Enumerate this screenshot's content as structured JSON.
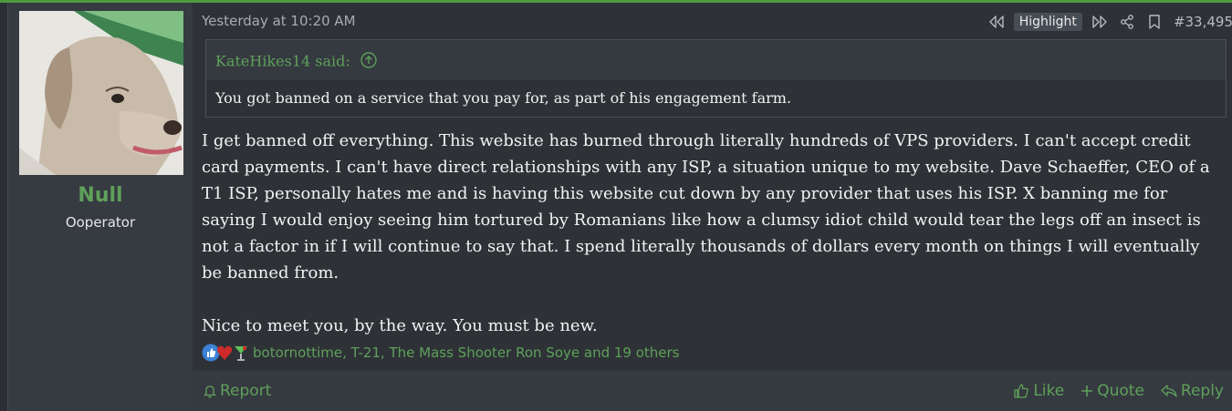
{
  "post": {
    "author": {
      "name": "Null",
      "title": "Ooperator",
      "avatar_icon": "dog-avatar"
    },
    "timestamp": "Yesterday at 10:20 AM",
    "actions": {
      "prev_icon": "rewind-icon",
      "highlight_label": "Highlight",
      "next_icon": "fast-forward-icon",
      "share_icon": "share-icon",
      "bookmark_icon": "bookmark-icon",
      "post_number": "#33,495"
    },
    "quote": {
      "author_said": "KateHikes14 said:",
      "text": "You got banned on a service that you pay for, as part of his engagement farm."
    },
    "body": {
      "paragraph_1": "I get banned off everything. This website has burned through literally hundreds of VPS providers. I can't accept credit card payments. I can't have direct relationships with any ISP, a situation unique to my website. Dave Schaeffer, CEO of a T1 ISP, personally hates me and is having this website cut down by any provider that uses his ISP. X banning me for saying I would enjoy seeing him tortured by Romanians like how a clumsy idiot child would tear the legs off an insect is not a factor in if I will continue to say that. I spend literally thousands of dollars every month on things I will eventually be banned from.",
      "paragraph_2": "Nice to meet you, by the way. You must be new."
    },
    "reactions": {
      "icons": [
        "thumbs-up-icon",
        "heart-icon",
        "cocktail-icon"
      ],
      "users_text": "botornottime, T-21, The Mass Shooter Ron Soye and 19 others"
    },
    "footer": {
      "report_label": "Report",
      "like_label": "Like",
      "quote_label": "Quote",
      "reply_label": "Reply"
    },
    "colors": {
      "accent": "#5fa05a",
      "background": "#2e3237"
    }
  }
}
